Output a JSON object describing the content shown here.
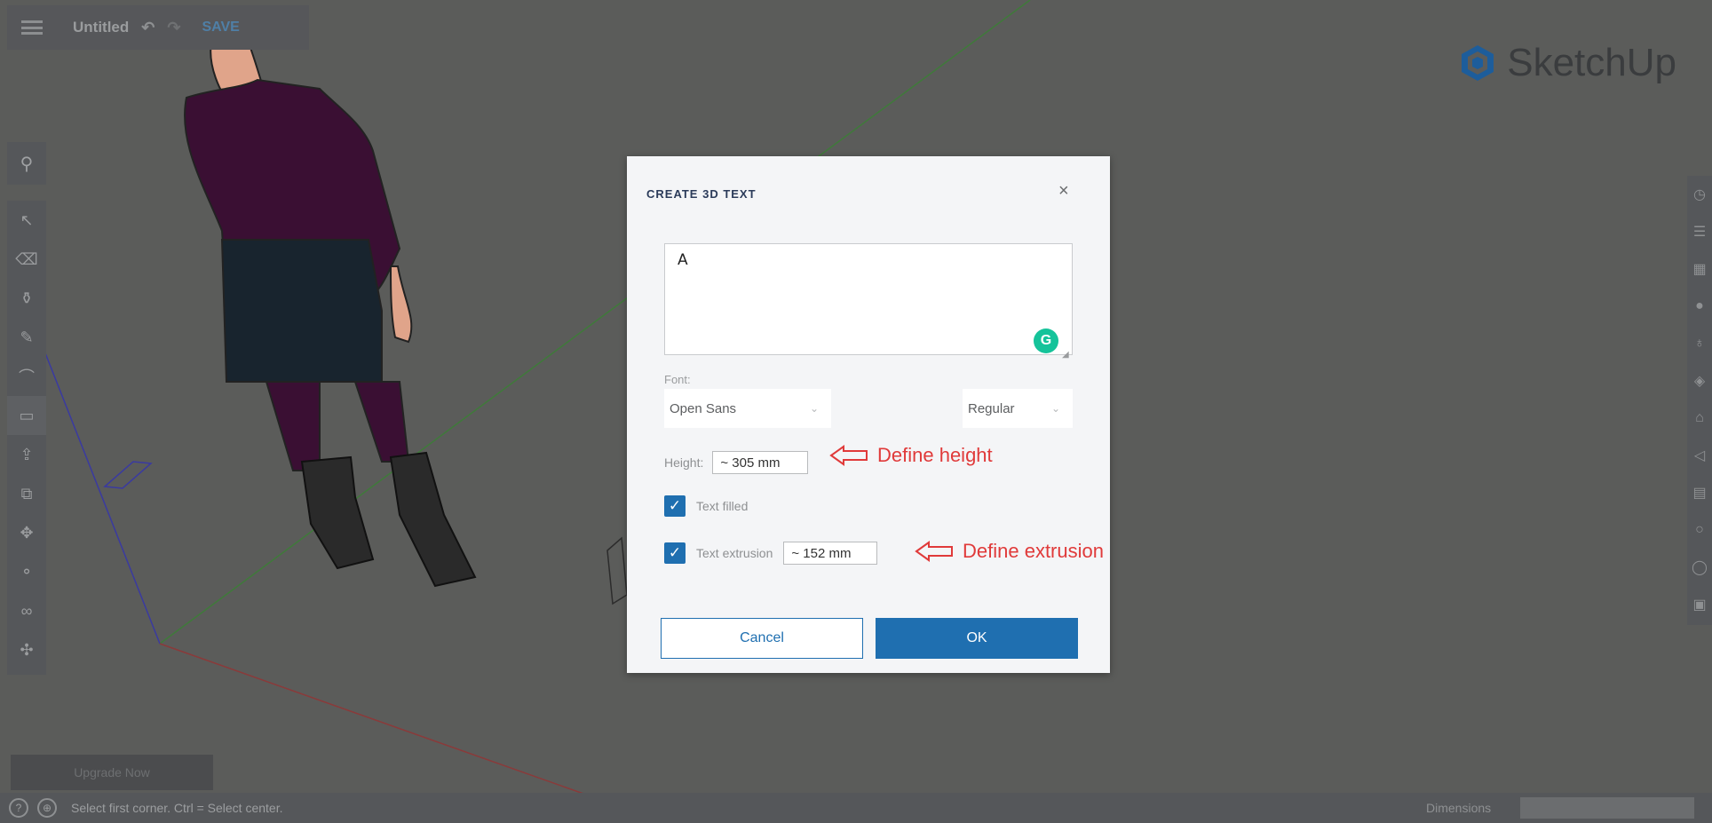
{
  "titlebar": {
    "document_title": "Untitled",
    "save_label": "SAVE"
  },
  "brand": {
    "name": "SketchUp"
  },
  "statusbar": {
    "status_text": "Select first corner. Ctrl = Select center.",
    "dimensions_label": "Dimensions"
  },
  "upgrade": {
    "label": "Upgrade Now"
  },
  "dialog": {
    "title": "CREATE 3D TEXT",
    "text_value": "A",
    "font_label": "Font:",
    "font_value": "Open Sans",
    "style_value": "Regular",
    "height_label": "Height:",
    "height_value": "~ 305 mm",
    "text_filled_label": "Text filled",
    "text_filled_checked": true,
    "text_extrusion_label": "Text extrusion",
    "text_extrusion_checked": true,
    "extrusion_value": "~ 152 mm",
    "cancel_label": "Cancel",
    "ok_label": "OK"
  },
  "annotations": {
    "height_note": "Define height",
    "extrusion_note": "Define extrusion"
  },
  "colors": {
    "viewport": "#5b5c5a",
    "accent_blue": "#1f6fb0",
    "annotation_red": "#e03a3a",
    "grammarly_green": "#15c39a"
  }
}
